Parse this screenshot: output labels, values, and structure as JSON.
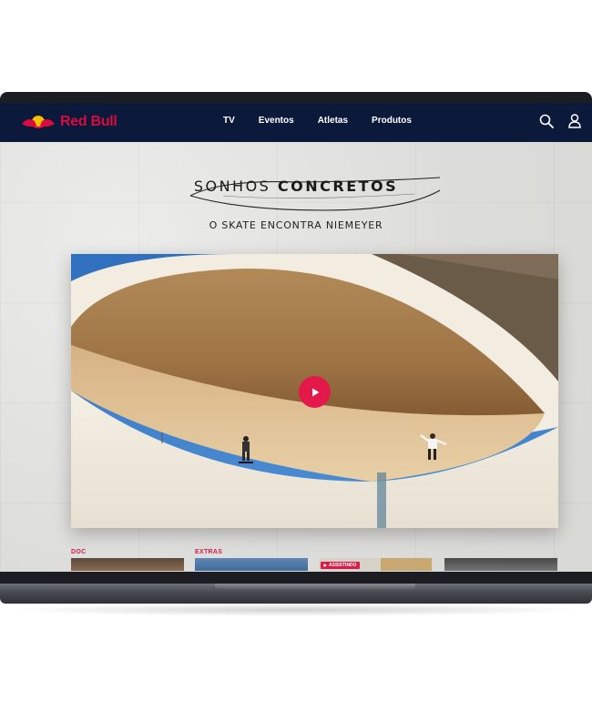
{
  "brand": {
    "name": "Red Bull",
    "color": "#db0a40",
    "nav_bg": "#0b1a3a"
  },
  "nav": {
    "items": [
      {
        "label": "TV"
      },
      {
        "label": "Eventos"
      },
      {
        "label": "Atletas"
      },
      {
        "label": "Produtos"
      }
    ],
    "icons": [
      "search-icon",
      "user-icon"
    ]
  },
  "hero": {
    "title_light": "SONHOS",
    "title_bold": "CONCRETOS",
    "subtitle": "O SKATE ENCONTRA NIEMEYER",
    "play_icon": "play-icon",
    "accent": "#e3184b"
  },
  "rows": {
    "categories": [
      "DOC",
      "EXTRAS"
    ],
    "badge": "ASSISTINDO"
  }
}
